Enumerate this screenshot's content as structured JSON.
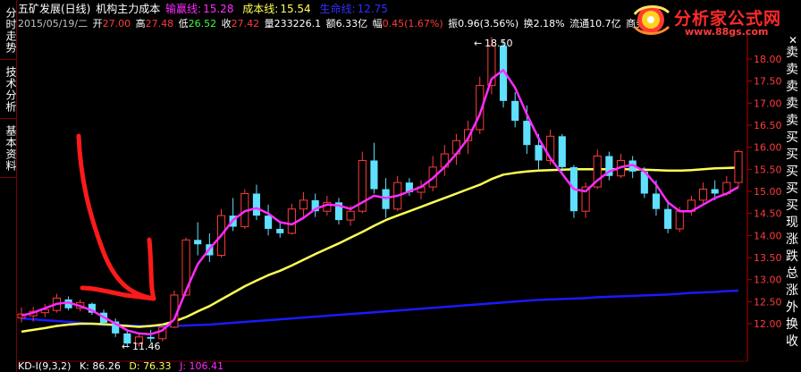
{
  "side_tabs": [
    {
      "label": "分时走势"
    },
    {
      "label": "技术分析"
    },
    {
      "label": "基本资料"
    }
  ],
  "header": {
    "stock_name": "五矿发展(日线)",
    "indicator_name": "机构主力成本",
    "win_line_label": "输赢线:",
    "win_line_value": "15.28",
    "cost_line_label": "成本线:",
    "cost_line_value": "15.54",
    "life_line_label": "生命线:",
    "life_line_value": "12.75",
    "date": "2015/05/19/二",
    "open_label": "开",
    "open_value": "27.00",
    "high_label": "高",
    "high_value": "27.48",
    "low_label": "低",
    "low_value": "26.52",
    "close_label": "收",
    "close_value": "27.42",
    "volume_label": "量",
    "volume_value": "233226.1",
    "amount_label": "额",
    "amount_value": "6.33亿",
    "change_label": "幅",
    "change_value": "0.45(1.67%)",
    "amplitude_label": "振",
    "amplitude_value": "0.96(3.56%)",
    "turnover_label": "换",
    "turnover_value": "2.18%",
    "float_label": "流通",
    "float_value": "10.7亿",
    "industry_label": "商务"
  },
  "logo": {
    "title": "分析家公式网",
    "url": "www.88gs.com"
  },
  "annotations": {
    "high_marker": "18.50",
    "low_marker": "11.46"
  },
  "price_axis": {
    "labels": [
      "18.00",
      "17.50",
      "17.00",
      "16.50",
      "16.00",
      "15.50",
      "15.00",
      "14.50",
      "14.00",
      "13.50",
      "13.00",
      "12.50",
      "12.00"
    ]
  },
  "right_strip": {
    "chars": [
      "卖",
      "卖",
      "卖",
      "卖",
      "卖",
      "买",
      "买",
      "买",
      "买",
      "买",
      "现",
      "涨",
      "跌",
      "总",
      "涨",
      "外",
      "换",
      "收"
    ]
  },
  "kd": {
    "name": "KD-I(9,3,2)",
    "k": "K: 86.26",
    "d": "D: 76.33",
    "j": "J: 106.41"
  },
  "colors": {
    "up": "#ff3b3b",
    "down": "#5fe0ff",
    "win_line": "#ff2bff",
    "cost_line": "#ffff55",
    "life_line": "#1a1aff",
    "axis": "#b30000"
  },
  "chart_data": {
    "type": "candlestick",
    "title": "",
    "ylim": [
      11.3,
      18.8
    ],
    "candles": [
      {
        "o": 12.13,
        "h": 12.37,
        "l": 12.03,
        "c": 12.22
      },
      {
        "o": 12.18,
        "h": 12.38,
        "l": 12.05,
        "c": 12.28
      },
      {
        "o": 12.25,
        "h": 12.45,
        "l": 12.15,
        "c": 12.32
      },
      {
        "o": 12.3,
        "h": 12.68,
        "l": 12.25,
        "c": 12.58
      },
      {
        "o": 12.55,
        "h": 12.62,
        "l": 12.3,
        "c": 12.35
      },
      {
        "o": 12.35,
        "h": 12.55,
        "l": 12.28,
        "c": 12.48
      },
      {
        "o": 12.45,
        "h": 12.48,
        "l": 12.2,
        "c": 12.25
      },
      {
        "o": 12.25,
        "h": 12.32,
        "l": 11.95,
        "c": 12.02
      },
      {
        "o": 12.05,
        "h": 12.12,
        "l": 11.7,
        "c": 11.78
      },
      {
        "o": 11.78,
        "h": 11.84,
        "l": 11.46,
        "c": 11.55
      },
      {
        "o": 11.55,
        "h": 11.78,
        "l": 11.48,
        "c": 11.7
      },
      {
        "o": 11.7,
        "h": 11.86,
        "l": 11.58,
        "c": 11.66
      },
      {
        "o": 11.66,
        "h": 11.98,
        "l": 11.6,
        "c": 11.92
      },
      {
        "o": 11.92,
        "h": 12.75,
        "l": 11.9,
        "c": 12.65
      },
      {
        "o": 12.65,
        "h": 13.95,
        "l": 12.62,
        "c": 13.9
      },
      {
        "o": 13.9,
        "h": 14.3,
        "l": 13.55,
        "c": 13.8
      },
      {
        "o": 13.8,
        "h": 14.05,
        "l": 13.4,
        "c": 13.55
      },
      {
        "o": 13.55,
        "h": 14.6,
        "l": 13.5,
        "c": 14.45
      },
      {
        "o": 14.45,
        "h": 14.85,
        "l": 14.1,
        "c": 14.2
      },
      {
        "o": 14.2,
        "h": 15.05,
        "l": 14.15,
        "c": 14.95
      },
      {
        "o": 14.95,
        "h": 15.15,
        "l": 14.35,
        "c": 14.45
      },
      {
        "o": 14.45,
        "h": 14.7,
        "l": 14.0,
        "c": 14.15
      },
      {
        "o": 14.15,
        "h": 14.3,
        "l": 13.95,
        "c": 14.05
      },
      {
        "o": 14.05,
        "h": 14.72,
        "l": 14.02,
        "c": 14.6
      },
      {
        "o": 14.6,
        "h": 14.98,
        "l": 14.4,
        "c": 14.8
      },
      {
        "o": 14.8,
        "h": 14.95,
        "l": 14.42,
        "c": 14.55
      },
      {
        "o": 14.55,
        "h": 14.9,
        "l": 14.45,
        "c": 14.75
      },
      {
        "o": 14.75,
        "h": 14.85,
        "l": 14.25,
        "c": 14.35
      },
      {
        "o": 14.35,
        "h": 14.68,
        "l": 14.22,
        "c": 14.55
      },
      {
        "o": 14.55,
        "h": 15.9,
        "l": 14.5,
        "c": 15.7
      },
      {
        "o": 15.7,
        "h": 16.1,
        "l": 14.95,
        "c": 15.05
      },
      {
        "o": 15.05,
        "h": 15.3,
        "l": 14.4,
        "c": 14.6
      },
      {
        "o": 14.6,
        "h": 15.35,
        "l": 14.55,
        "c": 15.2
      },
      {
        "o": 15.2,
        "h": 15.3,
        "l": 14.9,
        "c": 14.98
      },
      {
        "o": 14.98,
        "h": 15.25,
        "l": 14.82,
        "c": 15.1
      },
      {
        "o": 15.1,
        "h": 15.8,
        "l": 15.0,
        "c": 15.55
      },
      {
        "o": 15.55,
        "h": 16.05,
        "l": 15.35,
        "c": 15.85
      },
      {
        "o": 15.85,
        "h": 16.3,
        "l": 15.6,
        "c": 16.15
      },
      {
        "o": 16.15,
        "h": 16.6,
        "l": 15.85,
        "c": 16.4
      },
      {
        "o": 16.4,
        "h": 17.6,
        "l": 16.3,
        "c": 17.4
      },
      {
        "o": 17.4,
        "h": 18.5,
        "l": 17.2,
        "c": 18.3
      },
      {
        "o": 18.3,
        "h": 18.45,
        "l": 16.9,
        "c": 17.05
      },
      {
        "o": 17.05,
        "h": 17.25,
        "l": 16.45,
        "c": 16.6
      },
      {
        "o": 16.6,
        "h": 16.95,
        "l": 15.85,
        "c": 16.05
      },
      {
        "o": 16.05,
        "h": 16.3,
        "l": 15.5,
        "c": 15.7
      },
      {
        "o": 15.7,
        "h": 16.4,
        "l": 15.6,
        "c": 16.25
      },
      {
        "o": 16.25,
        "h": 16.3,
        "l": 15.45,
        "c": 15.55
      },
      {
        "o": 15.55,
        "h": 15.6,
        "l": 14.4,
        "c": 14.55
      },
      {
        "o": 14.55,
        "h": 15.2,
        "l": 14.4,
        "c": 15.1
      },
      {
        "o": 15.1,
        "h": 15.95,
        "l": 15.05,
        "c": 15.8
      },
      {
        "o": 15.8,
        "h": 15.9,
        "l": 15.25,
        "c": 15.35
      },
      {
        "o": 15.35,
        "h": 15.85,
        "l": 15.3,
        "c": 15.7
      },
      {
        "o": 15.7,
        "h": 15.8,
        "l": 15.3,
        "c": 15.45
      },
      {
        "o": 15.45,
        "h": 15.55,
        "l": 14.85,
        "c": 14.95
      },
      {
        "o": 14.95,
        "h": 15.25,
        "l": 14.45,
        "c": 14.6
      },
      {
        "o": 14.6,
        "h": 14.8,
        "l": 14.05,
        "c": 14.15
      },
      {
        "o": 14.15,
        "h": 14.65,
        "l": 14.08,
        "c": 14.55
      },
      {
        "o": 14.55,
        "h": 14.9,
        "l": 14.45,
        "c": 14.8
      },
      {
        "o": 14.8,
        "h": 15.2,
        "l": 14.7,
        "c": 15.05
      },
      {
        "o": 15.05,
        "h": 15.25,
        "l": 14.8,
        "c": 14.95
      },
      {
        "o": 14.95,
        "h": 15.35,
        "l": 14.9,
        "c": 15.2
      },
      {
        "o": 15.2,
        "h": 15.95,
        "l": 15.1,
        "c": 15.9
      }
    ],
    "win_line": [
      12.18,
      12.25,
      12.35,
      12.45,
      12.48,
      12.4,
      12.3,
      12.15,
      12.0,
      11.85,
      11.78,
      11.76,
      11.85,
      12.1,
      12.75,
      13.35,
      13.7,
      14.0,
      14.35,
      14.55,
      14.62,
      14.5,
      14.3,
      14.25,
      14.4,
      14.6,
      14.7,
      14.68,
      14.6,
      14.75,
      14.9,
      14.85,
      14.9,
      15.0,
      15.1,
      15.3,
      15.55,
      15.85,
      16.2,
      16.75,
      17.55,
      17.75,
      17.35,
      16.75,
      16.2,
      15.75,
      15.4,
      15.05,
      15.0,
      15.25,
      15.45,
      15.55,
      15.6,
      15.45,
      15.15,
      14.75,
      14.55,
      14.55,
      14.7,
      14.85,
      14.95,
      15.1
    ],
    "cost_line": [
      11.82,
      11.86,
      11.9,
      11.95,
      11.98,
      12.0,
      12.0,
      11.99,
      11.97,
      11.95,
      11.93,
      11.95,
      11.98,
      12.05,
      12.15,
      12.28,
      12.4,
      12.55,
      12.7,
      12.85,
      12.98,
      13.1,
      13.2,
      13.32,
      13.45,
      13.58,
      13.7,
      13.82,
      13.95,
      14.08,
      14.22,
      14.35,
      14.45,
      14.55,
      14.65,
      14.75,
      14.85,
      14.95,
      15.05,
      15.15,
      15.28,
      15.38,
      15.42,
      15.45,
      15.47,
      15.48,
      15.49,
      15.5,
      15.5,
      15.5,
      15.5,
      15.5,
      15.5,
      15.49,
      15.48,
      15.47,
      15.47,
      15.48,
      15.5,
      15.52,
      15.53,
      15.54
    ],
    "life_line": [
      12.12,
      12.1,
      12.08,
      12.06,
      12.04,
      12.02,
      12.0,
      11.98,
      11.97,
      11.96,
      11.95,
      11.95,
      11.95,
      11.95,
      11.96,
      11.97,
      11.98,
      12.0,
      12.02,
      12.04,
      12.06,
      12.08,
      12.1,
      12.12,
      12.14,
      12.16,
      12.18,
      12.2,
      12.22,
      12.24,
      12.26,
      12.28,
      12.3,
      12.32,
      12.34,
      12.36,
      12.38,
      12.4,
      12.42,
      12.44,
      12.46,
      12.48,
      12.5,
      12.52,
      12.54,
      12.55,
      12.56,
      12.57,
      12.58,
      12.6,
      12.61,
      12.62,
      12.63,
      12.64,
      12.65,
      12.66,
      12.68,
      12.7,
      12.71,
      12.72,
      12.74,
      12.75
    ]
  }
}
